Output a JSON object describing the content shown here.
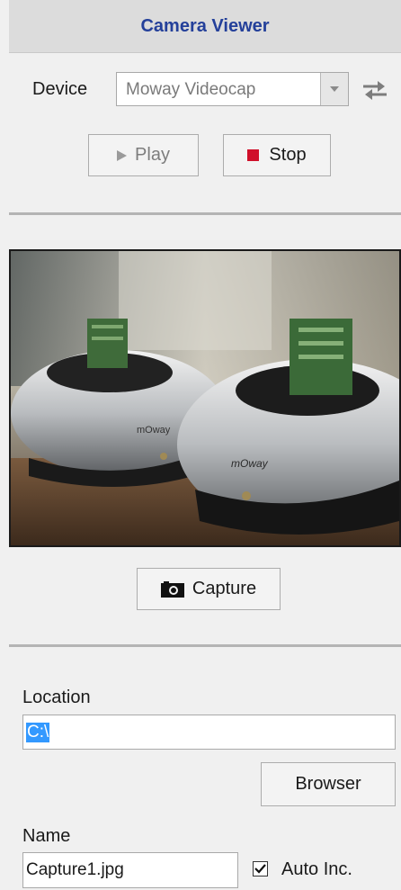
{
  "header": {
    "title": "Camera Viewer"
  },
  "device": {
    "label": "Device",
    "selected": "Moway Videocap",
    "dropdown_icon": "chevron-down-icon",
    "refresh_icon": "refresh-icon"
  },
  "controls": {
    "play_label": "Play",
    "stop_label": "Stop",
    "play_icon": "play-icon",
    "stop_icon": "stop-icon",
    "stop_color": "#d0102a"
  },
  "preview": {
    "branding": [
      "mOway",
      "mOway"
    ]
  },
  "capture": {
    "label": "Capture",
    "icon": "camera-icon"
  },
  "location": {
    "label": "Location",
    "value": "C:\\",
    "browse_label": "Browser"
  },
  "name": {
    "label": "Name",
    "value": "Capture1.jpg",
    "auto_inc_label": "Auto Inc.",
    "auto_inc_checked": true
  },
  "colors": {
    "header_title": "#24409a",
    "selection": "#3399ff"
  }
}
